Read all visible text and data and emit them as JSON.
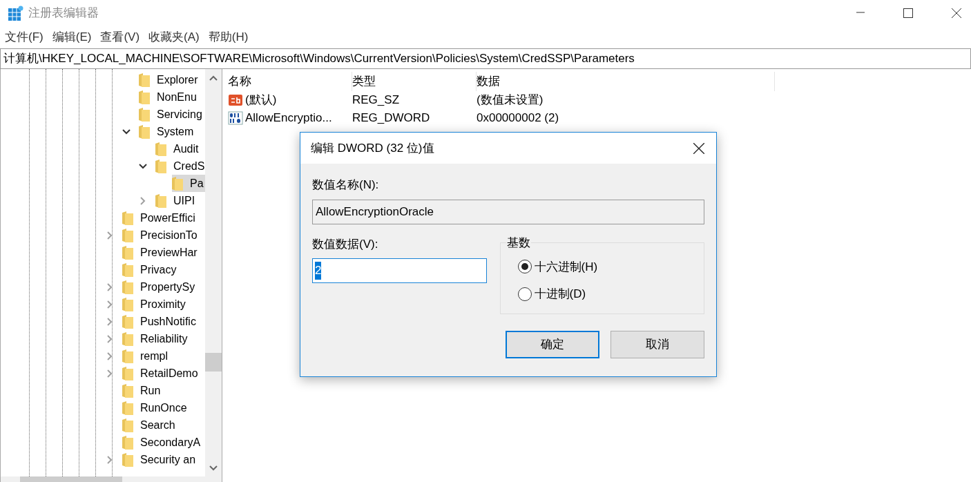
{
  "window": {
    "title": "注册表编辑器"
  },
  "menu": [
    "文件(F)",
    "编辑(E)",
    "查看(V)",
    "收藏夹(A)",
    "帮助(H)"
  ],
  "address": "计算机\\HKEY_LOCAL_MACHINE\\SOFTWARE\\Microsoft\\Windows\\CurrentVersion\\Policies\\System\\CredSSP\\Parameters",
  "tree": [
    {
      "children": [
        {
          "label": "Explorer",
          "has_children": false,
          "selected": false
        },
        {
          "label": "NonEnu",
          "has_children": false,
          "selected": false
        },
        {
          "label": "Servicing",
          "has_children": false,
          "selected": false
        },
        {
          "label": "System",
          "has_children": true,
          "expanded": true,
          "selected": false,
          "children": [
            {
              "label": "Audit",
              "has_children": false,
              "selected": false
            },
            {
              "label": "CredS",
              "has_children": true,
              "expanded": true,
              "selected": false,
              "children": [
                {
                  "label": "Pa",
                  "has_children": false,
                  "selected": true
                }
              ]
            },
            {
              "label": "UIPI",
              "has_children": true,
              "expanded": false,
              "selected": false
            }
          ]
        }
      ]
    },
    {
      "label": "PowerEffici",
      "has_children": false,
      "selected": false
    },
    {
      "label": "PrecisionTo",
      "has_children": true,
      "expanded": false,
      "selected": false
    },
    {
      "label": "PreviewHar",
      "has_children": false,
      "selected": false
    },
    {
      "label": "Privacy",
      "has_children": false,
      "selected": false
    },
    {
      "label": "PropertySy",
      "has_children": true,
      "expanded": false,
      "selected": false
    },
    {
      "label": "Proximity",
      "has_children": true,
      "expanded": false,
      "selected": false
    },
    {
      "label": "PushNotific",
      "has_children": true,
      "expanded": false,
      "selected": false
    },
    {
      "label": "Reliability",
      "has_children": true,
      "expanded": false,
      "selected": false
    },
    {
      "label": "rempl",
      "has_children": true,
      "expanded": false,
      "selected": false
    },
    {
      "label": "RetailDemo",
      "has_children": true,
      "expanded": false,
      "selected": false
    },
    {
      "label": "Run",
      "has_children": false,
      "selected": false
    },
    {
      "label": "RunOnce",
      "has_children": false,
      "selected": false
    },
    {
      "label": "Search",
      "has_children": false,
      "selected": false
    },
    {
      "label": "SecondaryA",
      "has_children": false,
      "selected": false
    },
    {
      "label": "Security an",
      "has_children": true,
      "expanded": false,
      "selected": false
    }
  ],
  "values": {
    "columns": [
      "名称",
      "类型",
      "数据"
    ],
    "rows": [
      {
        "kind": "string",
        "name": "(默认)",
        "type": "REG_SZ",
        "data": "(数值未设置)"
      },
      {
        "kind": "binary",
        "name": "AllowEncryptio...",
        "type": "REG_DWORD",
        "data": "0x00000002 (2)"
      }
    ]
  },
  "dialog": {
    "title": "编辑 DWORD (32 位)值",
    "name_label": "数值名称(N):",
    "name_value": "AllowEncryptionOracle",
    "data_label": "数值数据(V):",
    "data_value": "2",
    "base_label": "基数",
    "bases": [
      {
        "label": "十六进制(H)",
        "selected": true
      },
      {
        "label": "十进制(D)",
        "selected": false
      }
    ],
    "buttons": [
      {
        "label": "确定",
        "default": true
      },
      {
        "label": "取消",
        "default": false
      }
    ]
  }
}
